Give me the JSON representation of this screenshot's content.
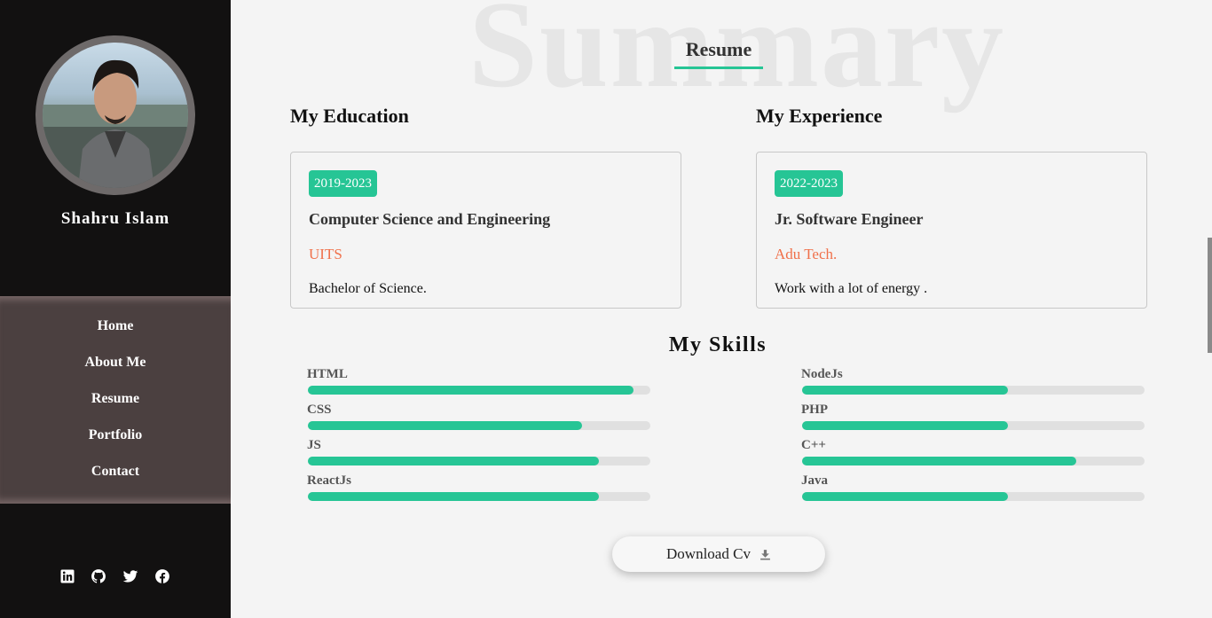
{
  "sidebar": {
    "name": "Shahru Islam",
    "nav": [
      "Home",
      "About Me",
      "Resume",
      "Portfolio",
      "Contact"
    ],
    "social": [
      "linkedin-icon",
      "github-icon",
      "twitter-icon",
      "facebook-icon"
    ]
  },
  "main": {
    "background_word": "Summary",
    "section_title": "Resume",
    "education": {
      "heading": "My Education",
      "years": "2019-2023",
      "title": "Computer Science and Engineering",
      "org": "UITS",
      "desc": "Bachelor of Science."
    },
    "experience": {
      "heading": "My Experience",
      "years": "2022-2023",
      "title": "Jr. Software Engineer",
      "org": "Adu Tech.",
      "desc": "Work with a lot of energy ."
    },
    "skills_heading": "My Skills",
    "skills_left": [
      {
        "name": "HTML",
        "level": 0.95
      },
      {
        "name": "CSS",
        "level": 0.8
      },
      {
        "name": "JS",
        "level": 0.85
      },
      {
        "name": "ReactJs",
        "level": 0.85
      }
    ],
    "skills_right": [
      {
        "name": "NodeJs",
        "level": 0.6
      },
      {
        "name": "PHP",
        "level": 0.6
      },
      {
        "name": "C++",
        "level": 0.8
      },
      {
        "name": "Java",
        "level": 0.6
      }
    ],
    "download_label": "Download Cv"
  },
  "colors": {
    "accent": "#26c595",
    "org": "#f0704a",
    "sidebar_bg": "#121111",
    "nav_bg": "#4b4040"
  }
}
